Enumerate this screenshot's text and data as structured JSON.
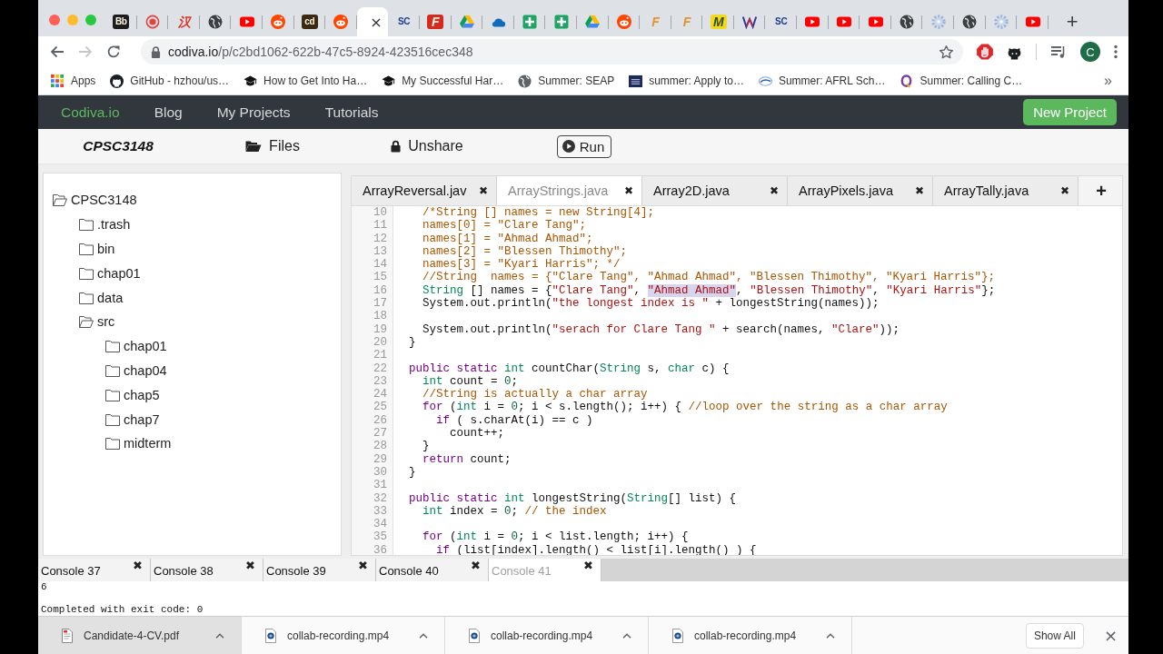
{
  "browser": {
    "tabs": [
      {
        "kind": "tile",
        "glyph": "Bb",
        "color": "#1c1c1c",
        "selected": false
      },
      {
        "kind": "record",
        "selected": false
      },
      {
        "kind": "glyph",
        "glyph": "汉",
        "color": "#d9362b",
        "selected": false
      },
      {
        "kind": "globe",
        "selected": false
      },
      {
        "kind": "video",
        "selected": false
      },
      {
        "kind": "face",
        "selected": false
      },
      {
        "kind": "tile",
        "glyph": "cd",
        "color": "#3b2a12",
        "selected": false
      },
      {
        "kind": "face",
        "selected": false
      },
      {
        "kind": "blank",
        "selected": true,
        "close": "×"
      },
      {
        "kind": "glyph",
        "glyph": "SC",
        "color": "#1d3f8a",
        "selected": false
      },
      {
        "kind": "tile",
        "glyph": "F",
        "color": "#d42a20",
        "selected": false
      },
      {
        "kind": "drive",
        "selected": false
      },
      {
        "kind": "cloud",
        "selected": false
      },
      {
        "kind": "sheets",
        "selected": false
      },
      {
        "kind": "sheets",
        "selected": false
      },
      {
        "kind": "drive",
        "selected": false
      },
      {
        "kind": "face",
        "selected": false
      },
      {
        "kind": "glyph",
        "glyph": "F",
        "color": "#e2952f",
        "selected": false
      },
      {
        "kind": "glyph",
        "glyph": "F",
        "color": "#e2952f",
        "selected": false
      },
      {
        "kind": "tile",
        "glyph": "M",
        "color": "#f4d81c",
        "selected": false
      },
      {
        "kind": "zigzag",
        "selected": false
      },
      {
        "kind": "glyph",
        "glyph": "SC",
        "color": "#1d3f8a",
        "selected": false
      },
      {
        "kind": "video",
        "selected": false
      },
      {
        "kind": "video",
        "selected": false
      },
      {
        "kind": "video",
        "selected": false
      },
      {
        "kind": "globe",
        "selected": false
      },
      {
        "kind": "gear",
        "selected": false
      },
      {
        "kind": "globe",
        "selected": false
      },
      {
        "kind": "gear",
        "selected": false
      },
      {
        "kind": "video",
        "selected": false
      }
    ],
    "new_tab": "+",
    "address": {
      "host": "codiva.io",
      "path": "/p/c2bd1062-622b-47c5-8924-423516cec348"
    },
    "profile": "C",
    "bookmarks": [
      {
        "kind": "grid",
        "label": "Apps"
      },
      {
        "kind": "cat",
        "label": "GitHub - hzhou/us…"
      },
      {
        "kind": "cap",
        "label": "How to Get Into Ha…"
      },
      {
        "kind": "cap",
        "label": "My Successful Har…"
      },
      {
        "kind": "globe",
        "label": "Summer: SEAP"
      },
      {
        "kind": "tile",
        "label": "summer: Apply to…"
      },
      {
        "kind": "swoosh",
        "label": "Summer: AFRL Sch…"
      },
      {
        "kind": "loop",
        "label": "Summer: Calling C…"
      }
    ],
    "bookmarks_more": "»"
  },
  "app": {
    "nav": {
      "brand": "Codiva.io",
      "links": [
        "Blog",
        "My Projects",
        "Tutorials"
      ],
      "new_project": "New Project"
    },
    "toolbar": {
      "project": "CPSC3148",
      "files": "Files",
      "unshare": "Unshare",
      "run": "Run"
    },
    "tree": {
      "label": "CPSC3148",
      "expanded": true,
      "children": [
        {
          "label": ".trash",
          "expanded": false
        },
        {
          "label": "bin",
          "expanded": false
        },
        {
          "label": "chap01",
          "expanded": false
        },
        {
          "label": "data",
          "expanded": false
        },
        {
          "label": "src",
          "expanded": true,
          "children": [
            {
              "label": "chap01",
              "expanded": false
            },
            {
              "label": "chap04",
              "expanded": false
            },
            {
              "label": "chap5",
              "expanded": false
            },
            {
              "label": "chap7",
              "expanded": false
            },
            {
              "label": "midterm",
              "expanded": false
            }
          ]
        }
      ]
    },
    "editor_tabs": [
      {
        "label": "ArrayReversal.jav",
        "close": "✖",
        "selected": false
      },
      {
        "label": "ArrayStrings.java",
        "close": "✖",
        "selected": true
      },
      {
        "label": "Array2D.java",
        "close": "✖",
        "selected": false
      },
      {
        "label": "ArrayPixels.java",
        "close": "✖",
        "selected": false
      },
      {
        "label": "ArrayTally.java",
        "close": "✖",
        "selected": false
      }
    ],
    "add_tab": "+",
    "code": [
      {
        "number": "10",
        "tokens": [
          {
            "kind": "comment",
            "text": "    /*String [] names = new String[4];"
          }
        ]
      },
      {
        "number": "11",
        "tokens": [
          {
            "kind": "comment",
            "text": "    names[0] = \"Clare Tang\";"
          }
        ]
      },
      {
        "number": "12",
        "tokens": [
          {
            "kind": "comment",
            "text": "    names[1] = \"Ahmad Ahmad\";"
          }
        ]
      },
      {
        "number": "13",
        "tokens": [
          {
            "kind": "comment",
            "text": "    names[2] = \"Blessen Thimothy\";"
          }
        ]
      },
      {
        "number": "14",
        "tokens": [
          {
            "kind": "comment",
            "text": "    names[3] = \"Kyari Harris\"; */"
          }
        ]
      },
      {
        "number": "15",
        "tokens": [
          {
            "kind": "comment",
            "text": "    //String  names = {\"Clare Tang\", \"Ahmad Ahmad\", \"Blessen Thimothy\", \"Kyari Harris\"};"
          }
        ]
      },
      {
        "number": "16",
        "tokens": [
          {
            "kind": "type",
            "text": "    String",
            "selected": false
          },
          {
            "kind": "plain",
            "text": " [] names = {",
            "selected": false
          },
          {
            "kind": "string",
            "text": "\"Clare Tang\"",
            "selected": false
          },
          {
            "kind": "plain",
            "text": ", ",
            "selected": false
          },
          {
            "kind": "string",
            "text": "\"Ahmad Ahmad\"",
            "selected": true
          },
          {
            "kind": "plain",
            "text": ", ",
            "selected": false
          },
          {
            "kind": "string",
            "text": "\"Blessen Thimothy\"",
            "selected": false
          },
          {
            "kind": "plain",
            "text": ", ",
            "selected": false
          },
          {
            "kind": "string",
            "text": "\"Kyari Harris\"",
            "selected": false
          },
          {
            "kind": "plain",
            "text": "};",
            "selected": false
          }
        ]
      },
      {
        "number": "17",
        "tokens": [
          {
            "kind": "plain",
            "text": "    System.out.println("
          },
          {
            "kind": "string",
            "text": "\"the longest index is \""
          },
          {
            "kind": "plain",
            "text": " + longestString(names));"
          }
        ]
      },
      {
        "number": "18"
      },
      {
        "number": "19",
        "tokens": [
          {
            "kind": "plain",
            "text": "    System.out.println("
          },
          {
            "kind": "string",
            "text": "\"serach for Clare Tang \""
          },
          {
            "kind": "plain",
            "text": " + search(names, "
          },
          {
            "kind": "string",
            "text": "\"Clare\""
          },
          {
            "kind": "plain",
            "text": "));"
          }
        ]
      },
      {
        "number": "20",
        "tokens": [
          {
            "kind": "plain",
            "text": "  }"
          }
        ]
      },
      {
        "number": "21"
      },
      {
        "number": "22",
        "tokens": [
          {
            "kind": "keyword",
            "text": "  public static"
          },
          {
            "kind": "type",
            "text": " int"
          },
          {
            "kind": "plain",
            "text": " countChar("
          },
          {
            "kind": "type",
            "text": "String"
          },
          {
            "kind": "plain",
            "text": " s, "
          },
          {
            "kind": "type",
            "text": "char"
          },
          {
            "kind": "plain",
            "text": " c) {"
          }
        ]
      },
      {
        "number": "23",
        "tokens": [
          {
            "kind": "type",
            "text": "    int"
          },
          {
            "kind": "plain",
            "text": " count = "
          },
          {
            "kind": "number",
            "text": "0"
          },
          {
            "kind": "plain",
            "text": ";"
          }
        ]
      },
      {
        "number": "24",
        "tokens": [
          {
            "kind": "comment",
            "text": "    //String is actually a char array"
          }
        ]
      },
      {
        "number": "25",
        "tokens": [
          {
            "kind": "keyword",
            "text": "    for"
          },
          {
            "kind": "plain",
            "text": " ("
          },
          {
            "kind": "type",
            "text": "int"
          },
          {
            "kind": "plain",
            "text": " i = "
          },
          {
            "kind": "number",
            "text": "0"
          },
          {
            "kind": "plain",
            "text": "; i < s.length(); i++) { "
          },
          {
            "kind": "comment",
            "text": "//loop over the string as a char array"
          }
        ]
      },
      {
        "number": "26",
        "tokens": [
          {
            "kind": "keyword",
            "text": "      if"
          },
          {
            "kind": "plain",
            "text": " ( s.charAt(i) == c )"
          }
        ]
      },
      {
        "number": "27",
        "tokens": [
          {
            "kind": "plain",
            "text": "        count++;"
          }
        ]
      },
      {
        "number": "28",
        "tokens": [
          {
            "kind": "plain",
            "text": "    }"
          }
        ]
      },
      {
        "number": "29",
        "tokens": [
          {
            "kind": "keyword",
            "text": "    return"
          },
          {
            "kind": "plain",
            "text": " count;"
          }
        ]
      },
      {
        "number": "30",
        "tokens": [
          {
            "kind": "plain",
            "text": "  }"
          }
        ]
      },
      {
        "number": "31"
      },
      {
        "number": "32",
        "tokens": [
          {
            "kind": "keyword",
            "text": "  public static"
          },
          {
            "kind": "type",
            "text": " int"
          },
          {
            "kind": "plain",
            "text": " longestString("
          },
          {
            "kind": "type",
            "text": "String"
          },
          {
            "kind": "plain",
            "text": "[] list) {"
          }
        ]
      },
      {
        "number": "33",
        "tokens": [
          {
            "kind": "type",
            "text": "    int"
          },
          {
            "kind": "plain",
            "text": " index = "
          },
          {
            "kind": "number",
            "text": "0"
          },
          {
            "kind": "plain",
            "text": "; "
          },
          {
            "kind": "comment",
            "text": "// the index"
          }
        ]
      },
      {
        "number": "34"
      },
      {
        "number": "35",
        "tokens": [
          {
            "kind": "keyword",
            "text": "    for"
          },
          {
            "kind": "plain",
            "text": " ("
          },
          {
            "kind": "type",
            "text": "int"
          },
          {
            "kind": "plain",
            "text": " i = "
          },
          {
            "kind": "number",
            "text": "0"
          },
          {
            "kind": "plain",
            "text": "; i < list.length; i++) {"
          }
        ]
      },
      {
        "number": "36",
        "tokens": [
          {
            "kind": "keyword",
            "text": "      if"
          },
          {
            "kind": "plain",
            "text": " (list[index].length() < list[i].length() ) {"
          }
        ]
      }
    ],
    "console_tabs": [
      {
        "label": "Console 37",
        "close": "✖",
        "selected": false
      },
      {
        "label": "Console 38",
        "close": "✖",
        "selected": false
      },
      {
        "label": "Console 39",
        "close": "✖",
        "selected": false
      },
      {
        "label": "Console 40",
        "close": "✖",
        "selected": false
      },
      {
        "label": "Console 41",
        "close": "✖",
        "selected": true
      }
    ],
    "console_output": [
      "6",
      "Completed with exit code: 0"
    ]
  },
  "downloads": {
    "items": [
      {
        "kind": "pdf",
        "name": "Candidate-4-CV.pdf",
        "selected": true
      },
      {
        "kind": "video",
        "name": "collab-recording.mp4",
        "selected": false
      },
      {
        "kind": "video",
        "name": "collab-recording.mp4",
        "selected": false
      },
      {
        "kind": "video",
        "name": "collab-recording.mp4",
        "selected": false
      }
    ],
    "show_all": "Show All",
    "close": "×"
  }
}
